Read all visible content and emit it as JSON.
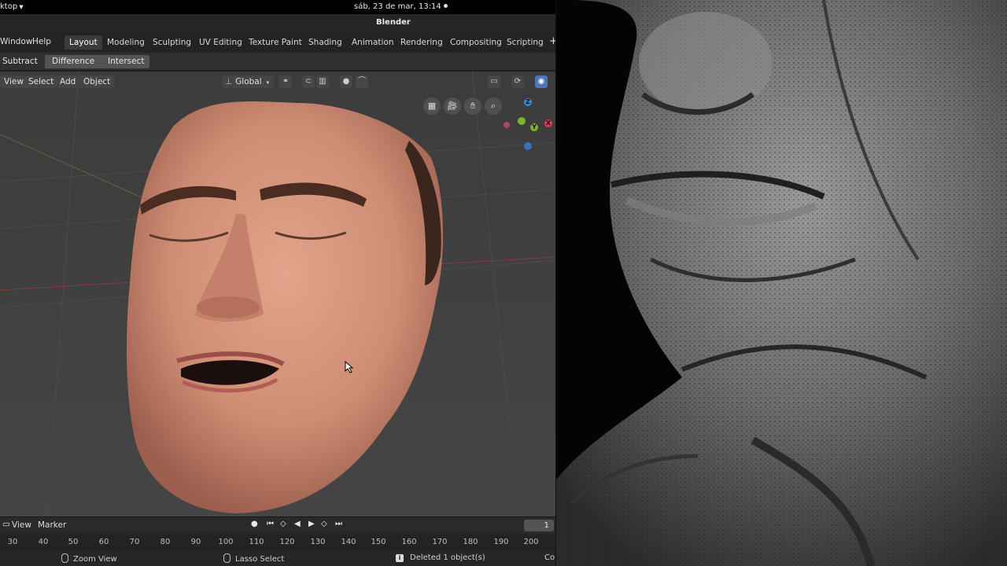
{
  "topbar": {
    "activities": "ktop",
    "clock": "sáb, 23 de mar, 13:14"
  },
  "window": {
    "title": "Blender"
  },
  "menu": {
    "items": [
      "Window",
      "Help"
    ]
  },
  "workspaces": {
    "active": "Layout",
    "tabs": [
      "Layout",
      "Modeling",
      "Sculpting",
      "UV Editing",
      "Texture Paint",
      "Shading",
      "Animation",
      "Rendering",
      "Compositing",
      "Scripting"
    ]
  },
  "boolean": {
    "buttons": [
      "Subtract",
      "Difference",
      "Intersect"
    ]
  },
  "viewport": {
    "menus": [
      "View",
      "Select",
      "Add",
      "Object"
    ],
    "orientation": "Global",
    "axes": {
      "z": "Z",
      "y": "Y",
      "x": "X"
    }
  },
  "timeline": {
    "menus": [
      "View",
      "Marker"
    ],
    "current_frame": "1",
    "ticks": [
      "30",
      "40",
      "50",
      "60",
      "70",
      "80",
      "90",
      "100",
      "110",
      "120",
      "130",
      "140",
      "150",
      "160",
      "170",
      "180",
      "190",
      "200"
    ]
  },
  "status": {
    "zoom": "Zoom View",
    "lasso": "Lasso Select",
    "message": "Deleted 1 object(s)",
    "right": "Col"
  },
  "colors": {
    "accent_blue": "#4b77b8",
    "axis_x": "#e23b4e",
    "axis_y": "#7fb32c",
    "axis_z": "#3b82e0"
  }
}
